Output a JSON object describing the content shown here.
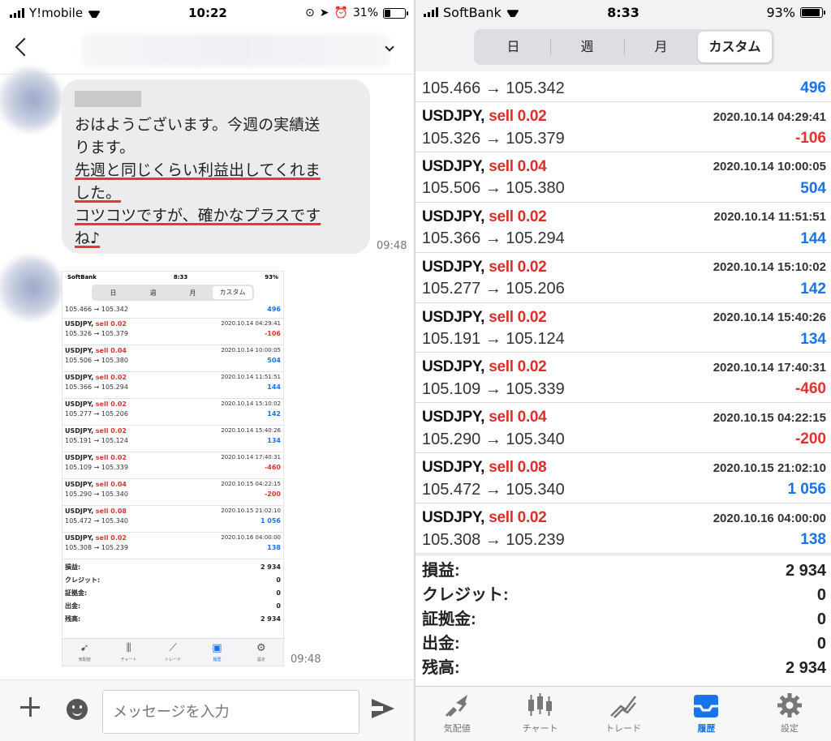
{
  "chat": {
    "status_bar": {
      "carrier": "Y!mobile",
      "time": "10:22",
      "battery": "31%"
    },
    "message": {
      "line1": "おはようございます。今週の実績送",
      "line2": "ります。",
      "line3": "先週と同じくらい利益出してくれま",
      "line4": "した。",
      "line5": "コツコツですが、確かなプラスです",
      "line6": "ね♪",
      "time": "09:48"
    },
    "image_time": "09:48",
    "input_placeholder": "メッセージを入力"
  },
  "history": {
    "status_bar": {
      "carrier": "SoftBank",
      "time": "8:33",
      "battery": "93%"
    },
    "segments": [
      "日",
      "週",
      "月",
      "カスタム"
    ],
    "selected_segment": "カスタム",
    "first_row": {
      "prices": "105.466 → 105.342",
      "profit": "496"
    },
    "trades": [
      {
        "symbol": "USDJPY,",
        "side": "sell 0.02",
        "date": "2020.10.14 04:29:41",
        "prices": "105.326 → 105.379",
        "profit": "-106"
      },
      {
        "symbol": "USDJPY,",
        "side": "sell 0.04",
        "date": "2020.10.14 10:00:05",
        "prices": "105.506 → 105.380",
        "profit": "504"
      },
      {
        "symbol": "USDJPY,",
        "side": "sell 0.02",
        "date": "2020.10.14 11:51:51",
        "prices": "105.366 → 105.294",
        "profit": "144"
      },
      {
        "symbol": "USDJPY,",
        "side": "sell 0.02",
        "date": "2020.10.14 15:10:02",
        "prices": "105.277 → 105.206",
        "profit": "142"
      },
      {
        "symbol": "USDJPY,",
        "side": "sell 0.02",
        "date": "2020.10.14 15:40:26",
        "prices": "105.191 → 105.124",
        "profit": "134"
      },
      {
        "symbol": "USDJPY,",
        "side": "sell 0.02",
        "date": "2020.10.14 17:40:31",
        "prices": "105.109 → 105.339",
        "profit": "-460"
      },
      {
        "symbol": "USDJPY,",
        "side": "sell 0.04",
        "date": "2020.10.15 04:22:15",
        "prices": "105.290 → 105.340",
        "profit": "-200"
      },
      {
        "symbol": "USDJPY,",
        "side": "sell 0.08",
        "date": "2020.10.15 21:02:10",
        "prices": "105.472 → 105.340",
        "profit": "1 056"
      },
      {
        "symbol": "USDJPY,",
        "side": "sell 0.02",
        "date": "2020.10.16 04:00:00",
        "prices": "105.308 → 105.239",
        "profit": "138"
      }
    ],
    "summary": [
      {
        "label": "損益:",
        "value": "2 934"
      },
      {
        "label": "クレジット:",
        "value": "0"
      },
      {
        "label": "証拠金:",
        "value": "0"
      },
      {
        "label": "出金:",
        "value": "0"
      },
      {
        "label": "残高:",
        "value": "2 934"
      }
    ],
    "tabs": [
      {
        "label": "気配値",
        "icon": "quotes-icon"
      },
      {
        "label": "チャート",
        "icon": "chart-icon"
      },
      {
        "label": "トレード",
        "icon": "trade-icon"
      },
      {
        "label": "履歴",
        "icon": "history-icon",
        "active": true
      },
      {
        "label": "設定",
        "icon": "settings-icon"
      }
    ]
  },
  "colors": {
    "profit": "#1a73e8",
    "loss": "#e0332f",
    "sell": "#d9302a",
    "active_tab": "#1a73e8",
    "underline": "#e33333"
  }
}
